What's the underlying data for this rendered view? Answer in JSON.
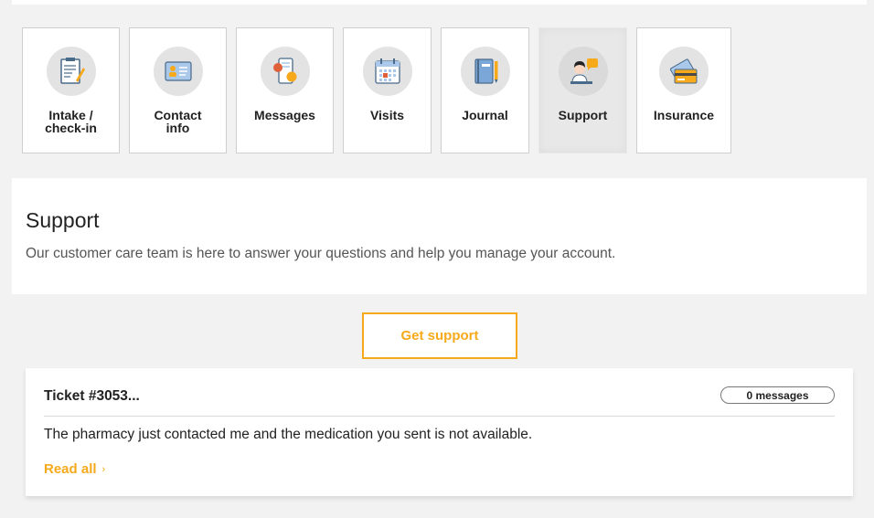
{
  "tiles": [
    {
      "label": "Intake /\ncheck-in",
      "icon": "clipboard-pen-icon",
      "active": false
    },
    {
      "label": "Contact\ninfo",
      "icon": "id-card-icon",
      "active": false
    },
    {
      "label": "Messages",
      "icon": "phone-chat-icon",
      "active": false
    },
    {
      "label": "Visits",
      "icon": "calendar-icon",
      "active": false
    },
    {
      "label": "Journal",
      "icon": "notebook-pencil-icon",
      "active": false
    },
    {
      "label": "Support",
      "icon": "support-agent-icon",
      "active": true
    },
    {
      "label": "Insurance",
      "icon": "insurance-card-icon",
      "active": false
    }
  ],
  "support": {
    "title": "Support",
    "description": "Our customer care team is here to answer your questions and help you manage your account.",
    "get_support_label": "Get support"
  },
  "ticket": {
    "title": "Ticket #3053...",
    "message_count": "0 messages",
    "body": "The pharmacy just contacted me and the medication you sent is not available.",
    "read_all_label": "Read all",
    "read_all_chevron": "›"
  },
  "colors": {
    "accent": "#f5a91b",
    "background": "#f2f2f2",
    "panel": "#ffffff"
  }
}
